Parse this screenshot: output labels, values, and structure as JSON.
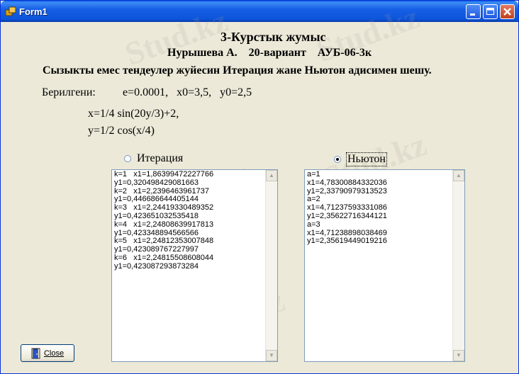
{
  "window": {
    "title": "Form1"
  },
  "watermark": "Stud.kz",
  "header": {
    "title": "3-Курстык жумыс",
    "author_line": "Нурышева А.    20-вариант    АУБ-06-3к",
    "task": "Сызыкты емес тендеулер жуйесин Итерация жане Ньютон адисимен шешу."
  },
  "given": {
    "label": "Берилгени:",
    "params": "e=0.0001,   x0=3,5,   y0=2,5"
  },
  "equations": {
    "eq1": "x=1/4 sin(20y/3)+2,",
    "eq2": "y=1/2 cos(x/4)"
  },
  "methods": {
    "iteration": {
      "label": "Итерация",
      "selected": false
    },
    "newton": {
      "label": "Ньютон",
      "selected": true
    }
  },
  "iteration_output": [
    "k=1   x1=1,86399472227766",
    "y1=0,320498429081663",
    "k=2   x1=2,2396463961737",
    "y1=0,446686644405144",
    "k=3   x1=2,24419330489352",
    "y1=0,423651032535418",
    "k=4   x1=2,24808639917813",
    "y1=0,423348894566566",
    "k=5   x1=2,24812353007848",
    "y1=0,423089767227997",
    "k=6   x1=2,24815508608044",
    "y1=0,423087293873284"
  ],
  "newton_output": [
    "a=1",
    "x1=4,78300884332036",
    "y1=2,33790979313523",
    "a=2",
    "x1=4,71237593331086",
    "y1=2,35622716344121",
    "a=3",
    "x1=4,71238898038469",
    "y1=2,35619449019216"
  ],
  "buttons": {
    "close": "Close"
  }
}
